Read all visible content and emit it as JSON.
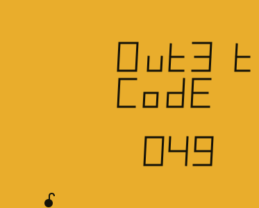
{
  "display": {
    "line1": "Out3 t",
    "line2": "CodE",
    "line3": "049"
  },
  "icons": {
    "lock": "unlocked-padlock-icon"
  },
  "colors": {
    "lcd_background": "#e9ad2c",
    "segment_ink": "#141208"
  }
}
